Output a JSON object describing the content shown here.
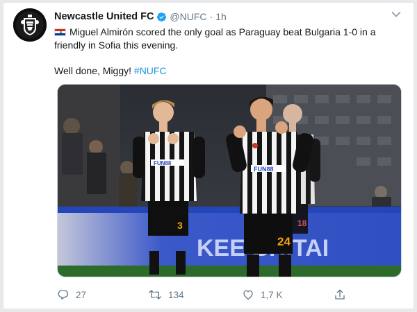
{
  "tweet": {
    "author": {
      "display_name": "Newcastle United FC",
      "handle": "@NUFC",
      "verified": true
    },
    "separator": "·",
    "time": "1h",
    "text_line1": "Miguel Almirón scored the only goal as Paraguay beat Bulgaria 1-0 in a friendly in Sofia this evening.",
    "text_line2": "Well done, Miggy!",
    "hashtag": "#NUFC",
    "flag": "paraguay-flag-icon",
    "photo": {
      "player_left_number": "3",
      "player_center_number": "24",
      "player_right_number": "18",
      "sponsor": "FUN88",
      "board_text": "KEE   BRITAI"
    },
    "actions": {
      "replies": "27",
      "retweets": "134",
      "likes": "1,7 K"
    },
    "colors": {
      "link": "#1b95e0",
      "verified": "#1da1f2",
      "muted": "#657786"
    }
  }
}
